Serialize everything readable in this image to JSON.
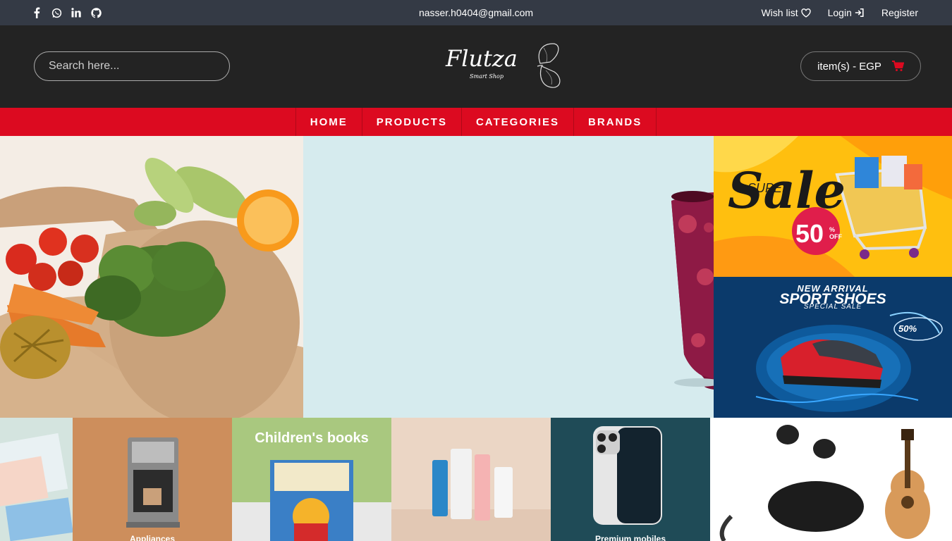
{
  "topbar": {
    "social": [
      {
        "icon": "facebook-icon",
        "glyph": "f"
      },
      {
        "icon": "whatsapp-icon",
        "glyph": "◌"
      },
      {
        "icon": "linkedin-icon",
        "glyph": "in"
      },
      {
        "icon": "github-icon",
        "glyph": "●"
      }
    ],
    "email": "nasser.h0404@gmail.com",
    "links": {
      "wishlist": "Wish list",
      "login": "Login",
      "register": "Register"
    }
  },
  "header": {
    "search_placeholder": "Search here...",
    "logo_text": "Flutza",
    "logo_sub": "Smart Shop",
    "cart_label": "item(s) - EGP"
  },
  "nav": [
    "HOME",
    "PRODUCTS",
    "CATEGORIES",
    "BRANDS"
  ],
  "promos": {
    "sale_title": "Sale",
    "sale_super": "SUPER",
    "sale_percent": "50",
    "sale_off": "% OFF",
    "shoes_top": "NEW ARRIVAL",
    "shoes_title": "SPORT SHOES",
    "shoes_sub": "SPECIAL SALE",
    "shoes_percent": "50%"
  },
  "categories": [
    {
      "name": "baby",
      "label": ""
    },
    {
      "name": "appliances",
      "label": "Appliances"
    },
    {
      "name": "books",
      "label": "Children's books"
    },
    {
      "name": "beauty",
      "label": ""
    },
    {
      "name": "mobiles",
      "label": "Premium mobiles"
    },
    {
      "name": "electronics",
      "label": ""
    }
  ],
  "colors": {
    "topbar": "#343a45",
    "header": "#232323",
    "nav": "#dc0a20",
    "accent": "#dc0a20"
  }
}
